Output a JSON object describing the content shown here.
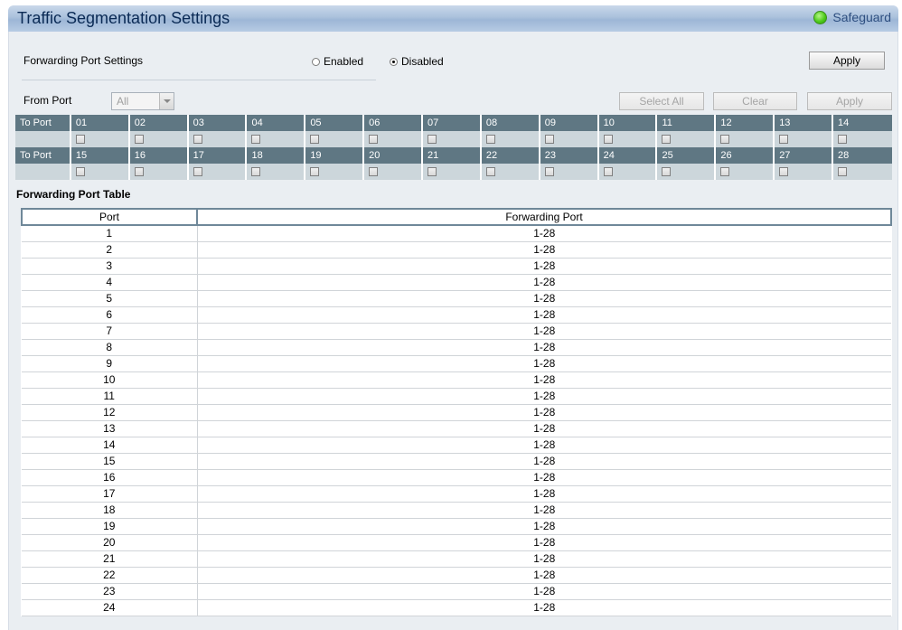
{
  "title": "Traffic Segmentation Settings",
  "safeguard": "Safeguard",
  "forwarding": {
    "label": "Forwarding Port Settings",
    "enabled_label": "Enabled",
    "disabled_label": "Disabled",
    "selected": "Disabled",
    "apply_label": "Apply"
  },
  "from_port": {
    "label": "From Port",
    "value": "All",
    "select_all_label": "Select All",
    "clear_label": "Clear",
    "apply_label": "Apply"
  },
  "port_grid": {
    "row_label": "To Port",
    "rows": [
      [
        "01",
        "02",
        "03",
        "04",
        "05",
        "06",
        "07",
        "08",
        "09",
        "10",
        "11",
        "12",
        "13",
        "14"
      ],
      [
        "15",
        "16",
        "17",
        "18",
        "19",
        "20",
        "21",
        "22",
        "23",
        "24",
        "25",
        "26",
        "27",
        "28"
      ]
    ]
  },
  "table": {
    "title": "Forwarding Port Table",
    "headers": [
      "Port",
      "Forwarding Port"
    ],
    "rows": [
      [
        "1",
        "1-28"
      ],
      [
        "2",
        "1-28"
      ],
      [
        "3",
        "1-28"
      ],
      [
        "4",
        "1-28"
      ],
      [
        "5",
        "1-28"
      ],
      [
        "6",
        "1-28"
      ],
      [
        "7",
        "1-28"
      ],
      [
        "8",
        "1-28"
      ],
      [
        "9",
        "1-28"
      ],
      [
        "10",
        "1-28"
      ],
      [
        "11",
        "1-28"
      ],
      [
        "12",
        "1-28"
      ],
      [
        "13",
        "1-28"
      ],
      [
        "14",
        "1-28"
      ],
      [
        "15",
        "1-28"
      ],
      [
        "16",
        "1-28"
      ],
      [
        "17",
        "1-28"
      ],
      [
        "18",
        "1-28"
      ],
      [
        "19",
        "1-28"
      ],
      [
        "20",
        "1-28"
      ],
      [
        "21",
        "1-28"
      ],
      [
        "22",
        "1-28"
      ],
      [
        "23",
        "1-28"
      ],
      [
        "24",
        "1-28"
      ]
    ]
  },
  "colors": {
    "port_header_bg": "#5f7783",
    "port_check_bg": "#ccd6db",
    "safeguard_dot": "#4ecb1b"
  }
}
